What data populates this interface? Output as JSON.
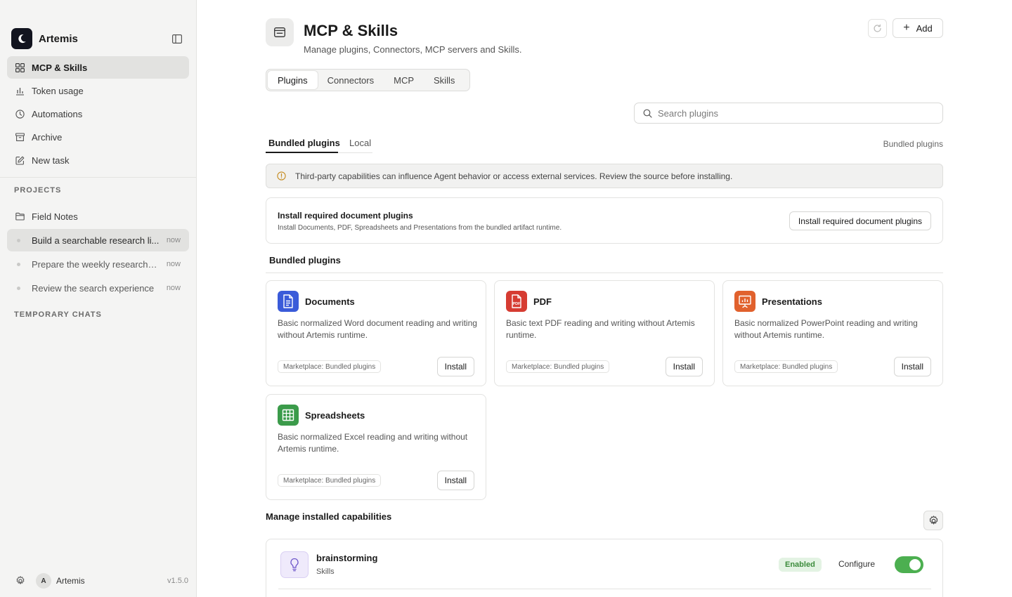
{
  "sidebar": {
    "brand": "Artemis",
    "nav": [
      {
        "label": "MCP & Skills",
        "icon": "grid-icon",
        "active": true
      },
      {
        "label": "Token usage",
        "icon": "bar-chart-icon"
      },
      {
        "label": "Automations",
        "icon": "clock-icon"
      },
      {
        "label": "Archive",
        "icon": "archive-icon"
      },
      {
        "label": "New task",
        "icon": "edit-icon"
      }
    ],
    "projects_label": "PROJECTS",
    "project": {
      "label": "Field Notes",
      "icon": "folder-icon"
    },
    "chats": [
      {
        "title": "Build a searchable research li...",
        "time": "now",
        "active": true
      },
      {
        "title": "Prepare the weekly research b...",
        "time": "now"
      },
      {
        "title": "Review the search experience",
        "time": "now"
      }
    ],
    "temporary_label": "TEMPORARY CHATS",
    "footer": {
      "avatar": "A",
      "user": "Artemis",
      "version": "v1.5.0"
    }
  },
  "header": {
    "title": "MCP & Skills",
    "subtitle": "Manage plugins, Connectors, MCP servers and Skills.",
    "add_label": "Add"
  },
  "tabs": [
    "Plugins",
    "Connectors",
    "MCP",
    "Skills"
  ],
  "search": {
    "placeholder": "Search plugins"
  },
  "subtabs": {
    "items": [
      "Bundled plugins",
      "Local"
    ],
    "right_label": "Bundled plugins"
  },
  "warning": "Third-party capabilities can influence Agent behavior or access external services. Review the source before installing.",
  "required": {
    "title": "Install required document plugins",
    "description": "Install Documents, PDF, Spreadsheets and Presentations from the bundled artifact runtime.",
    "button": "Install required document plugins"
  },
  "bundled_title": "Bundled plugins",
  "plugins": [
    {
      "name": "Documents",
      "description": "Basic normalized Word document reading and writing without Artemis runtime.",
      "badge": "Marketplace: Bundled plugins",
      "button": "Install",
      "color": "#3a5bd9",
      "icon": "document-icon"
    },
    {
      "name": "PDF",
      "description": "Basic text PDF reading and writing without Artemis runtime.",
      "badge": "Marketplace: Bundled plugins",
      "button": "Install",
      "color": "#d63c32",
      "icon": "pdf-icon"
    },
    {
      "name": "Presentations",
      "description": "Basic normalized PowerPoint reading and writing without Artemis runtime.",
      "badge": "Marketplace: Bundled plugins",
      "button": "Install",
      "color": "#e1612d",
      "icon": "presentation-icon"
    },
    {
      "name": "Spreadsheets",
      "description": "Basic normalized Excel reading and writing without Artemis runtime.",
      "badge": "Marketplace: Bundled plugins",
      "button": "Install",
      "color": "#3b9b4a",
      "icon": "spreadsheet-icon"
    }
  ],
  "manage": {
    "title": "Manage installed capabilities",
    "items": [
      {
        "name": "brainstorming",
        "kind": "Skills",
        "status": "Enabled",
        "configure": "Configure",
        "icon": "lightbulb-icon",
        "enabled": true
      }
    ]
  }
}
